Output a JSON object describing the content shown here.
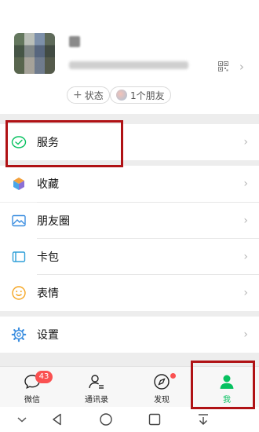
{
  "profile": {
    "avatar_icon": "blurred-avatar-image",
    "qr_icon": "qr-code-icon",
    "chips": [
      {
        "icon": "plus-icon",
        "label": "状态"
      },
      {
        "icon": "friend-avatar-icon",
        "label": "1个朋友"
      }
    ]
  },
  "menu": {
    "service": {
      "label": "服务",
      "icon": "wechat-pay-icon"
    },
    "favorites": {
      "label": "收藏",
      "icon": "cube-icon"
    },
    "moments": {
      "label": "朋友圈",
      "icon": "photo-icon"
    },
    "cards": {
      "label": "卡包",
      "icon": "card-icon"
    },
    "stickers": {
      "label": "表情",
      "icon": "smiley-icon"
    },
    "settings": {
      "label": "设置",
      "icon": "gear-icon"
    }
  },
  "tabbar": {
    "tabs": [
      {
        "label": "微信",
        "icon": "chat-bubble-icon",
        "badge": "43"
      },
      {
        "label": "通讯录",
        "icon": "contacts-icon"
      },
      {
        "label": "发现",
        "icon": "compass-icon",
        "dot": true
      },
      {
        "label": "我",
        "icon": "person-icon",
        "active": true
      }
    ]
  },
  "colors": {
    "accent_green": "#07c160",
    "highlight_red": "#b01215",
    "badge_red": "#fa5151"
  }
}
